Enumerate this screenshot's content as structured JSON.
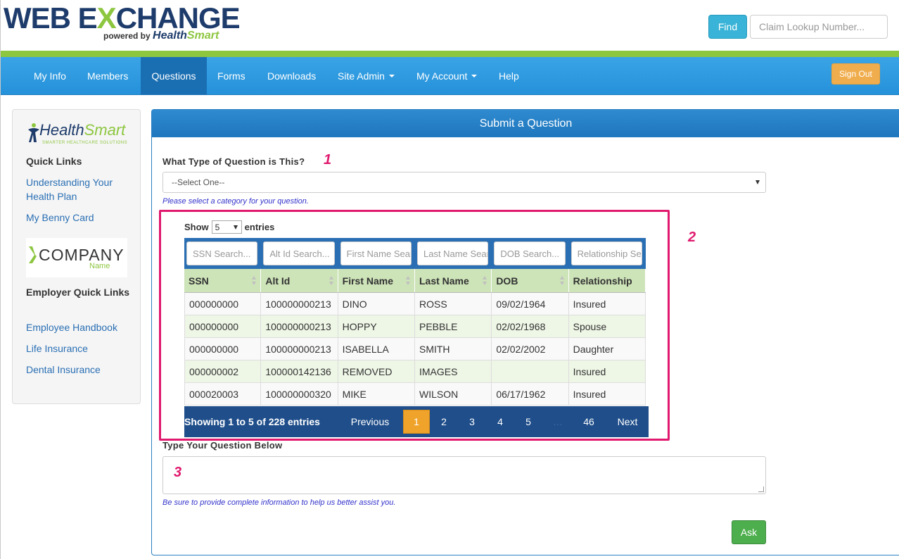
{
  "header": {
    "logo_part1": "WEB E",
    "logo_part2": "X",
    "logo_part3": "CHANGE",
    "powered_by": "powered by ",
    "hs_health": "Health",
    "hs_smart": "Smart",
    "find_label": "Find",
    "claim_placeholder": "Claim Lookup Number..."
  },
  "nav": {
    "items": [
      {
        "label": "My Info"
      },
      {
        "label": "Members"
      },
      {
        "label": "Questions"
      },
      {
        "label": "Forms"
      },
      {
        "label": "Downloads"
      },
      {
        "label": "Site Admin"
      },
      {
        "label": "My Account"
      },
      {
        "label": "Help"
      }
    ],
    "signout_label": "Sign Out"
  },
  "sidebar": {
    "logo_health": "Health",
    "logo_smart": "Smart",
    "logo_tag": "SMARTER HEALTHCARE SOLUTIONS",
    "quick_links_title": "Quick Links",
    "quick_links": [
      "Understanding Your Health Plan",
      "My Benny Card"
    ],
    "company_name": "COMPANY",
    "company_sub": "Name",
    "employer_title": "Employer Quick Links",
    "employer_links": [
      "Employee Handbook",
      "Life Insurance",
      "Dental Insurance"
    ]
  },
  "main": {
    "title": "Submit a Question",
    "question_type_label": "What Type of Question is This?",
    "question_type_value": "--Select One--",
    "question_type_hint": "Please select a category for your question.",
    "markers": [
      "1",
      "2",
      "3"
    ],
    "show_label": "Show",
    "show_value": "5",
    "entries_label": "entries",
    "search_placeholders": [
      "SSN Search...",
      "Alt Id Search...",
      "First Name Search...",
      "Last Name Search...",
      "DOB Search...",
      "Relationship Search..."
    ],
    "columns": [
      "SSN",
      "Alt Id",
      "First Name",
      "Last Name",
      "DOB",
      "Relationship"
    ],
    "rows": [
      [
        "000000000",
        "100000000213",
        "DINO",
        "ROSS",
        "09/02/1964",
        "Insured"
      ],
      [
        "000000000",
        "100000000213",
        "HOPPY",
        "PEBBLE",
        "02/02/1968",
        "Spouse"
      ],
      [
        "000000000",
        "100000000213",
        "ISABELLA",
        "SMITH",
        "02/02/2002",
        "Daughter"
      ],
      [
        "000000002",
        "100000142136",
        "REMOVED",
        "IMAGES",
        "",
        "Insured"
      ],
      [
        "000020003",
        "100000000320",
        "MIKE",
        "WILSON",
        "06/17/1962",
        "Insured"
      ]
    ],
    "pager_info": "Showing 1 to 5 of 228 entries",
    "pager_prev": "Previous",
    "pager_pages": [
      "1",
      "2",
      "3",
      "4",
      "5"
    ],
    "pager_ellipsis": "…",
    "pager_last": "46",
    "pager_next": "Next",
    "question_label": "Type Your Question Below",
    "question_hint": "Be sure to provide complete information to help us better assist you.",
    "ask_label": "Ask"
  }
}
